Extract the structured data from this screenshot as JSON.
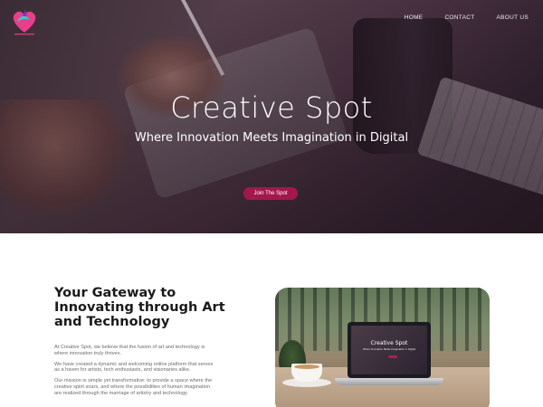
{
  "nav": {
    "items": [
      {
        "label": "HOME"
      },
      {
        "label": "CONTACT"
      },
      {
        "label": "ABOUT US"
      }
    ]
  },
  "hero": {
    "title": "Creative Spot",
    "subtitle": "Where Innovation Meets Imagination in Digital",
    "cta_label": "Join The Spot"
  },
  "about": {
    "title": "Your Gateway to Innovating through Art and Technology",
    "paragraphs": [
      "At Creative Spot, we believe that the fusion of art and technology is where innovation truly thrives.",
      "We have created a dynamic and welcoming online platform that serves as a haven for artists, tech enthusiasts, and visionaries alike.",
      "Our mission is simple yet transformative: to provide a space where the creative spirit soars, and where the possibilities of human imagination are realized through the marriage of artistry and technology."
    ]
  },
  "photo": {
    "screen_title": "Creative Spot",
    "screen_subtitle": "Where Innovation Meets Imagination in Digital"
  },
  "colors": {
    "accent": "#a3184b",
    "logo_pink": "#e83e8c",
    "logo_teal": "#3cc6c6"
  }
}
